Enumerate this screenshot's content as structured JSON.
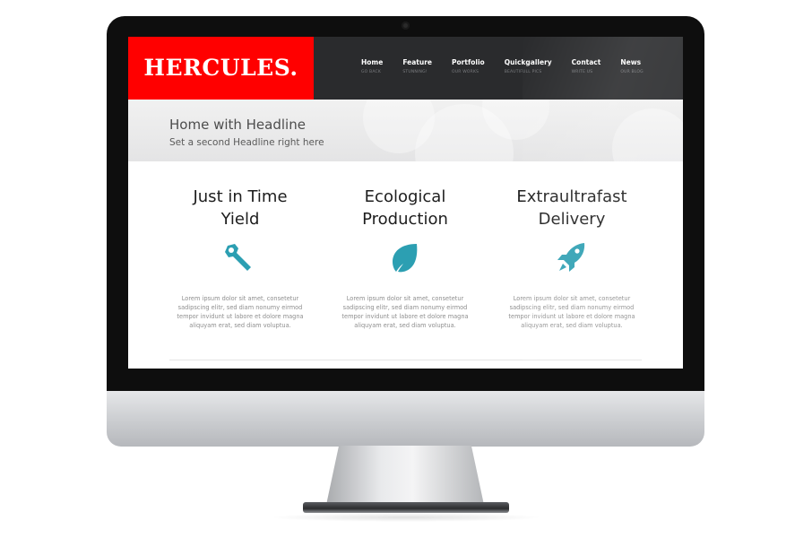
{
  "brand": {
    "logo": "HERCULES.",
    "accent": "#ff0000",
    "header_bg": "#2a2b2d",
    "icon_color": "#2c9fb2"
  },
  "nav": {
    "items": [
      {
        "label": "Home",
        "sub": "GO BACK"
      },
      {
        "label": "Feature",
        "sub": "STUNNING!"
      },
      {
        "label": "Portfolio",
        "sub": "OUR WORKS"
      },
      {
        "label": "Quickgallery",
        "sub": "BEAUTIFULL PICS"
      },
      {
        "label": "Contact",
        "sub": "WRITE US"
      },
      {
        "label": "News",
        "sub": "OUR BLOG"
      }
    ]
  },
  "hero": {
    "title": "Home with Headline",
    "subtitle": "Set a second Headline right here"
  },
  "features": [
    {
      "title_line1": "Just in Time",
      "title_line2": "Yield",
      "icon": "wrench-icon",
      "body": "Lorem ipsum dolor sit amet, consetetur sadipscing elitr, sed diam nonumy eirmod tempor invidunt ut labore et dolore magna aliquyam erat, sed diam voluptua."
    },
    {
      "title_line1": "Ecological",
      "title_line2": "Production",
      "icon": "leaf-icon",
      "body": "Lorem ipsum dolor sit amet, consetetur sadipscing elitr, sed diam nonumy eirmod tempor invidunt ut labore et dolore magna aliquyam erat, sed diam voluptua."
    },
    {
      "title_line1": "Extraultrafast",
      "title_line2": "Delivery",
      "icon": "rocket-icon",
      "body": "Lorem ipsum dolor sit amet, consetetur sadipscing elitr, sed diam nonumy eirmod tempor invidunt ut labore et dolore magna aliquyam erat, sed diam voluptua."
    }
  ]
}
